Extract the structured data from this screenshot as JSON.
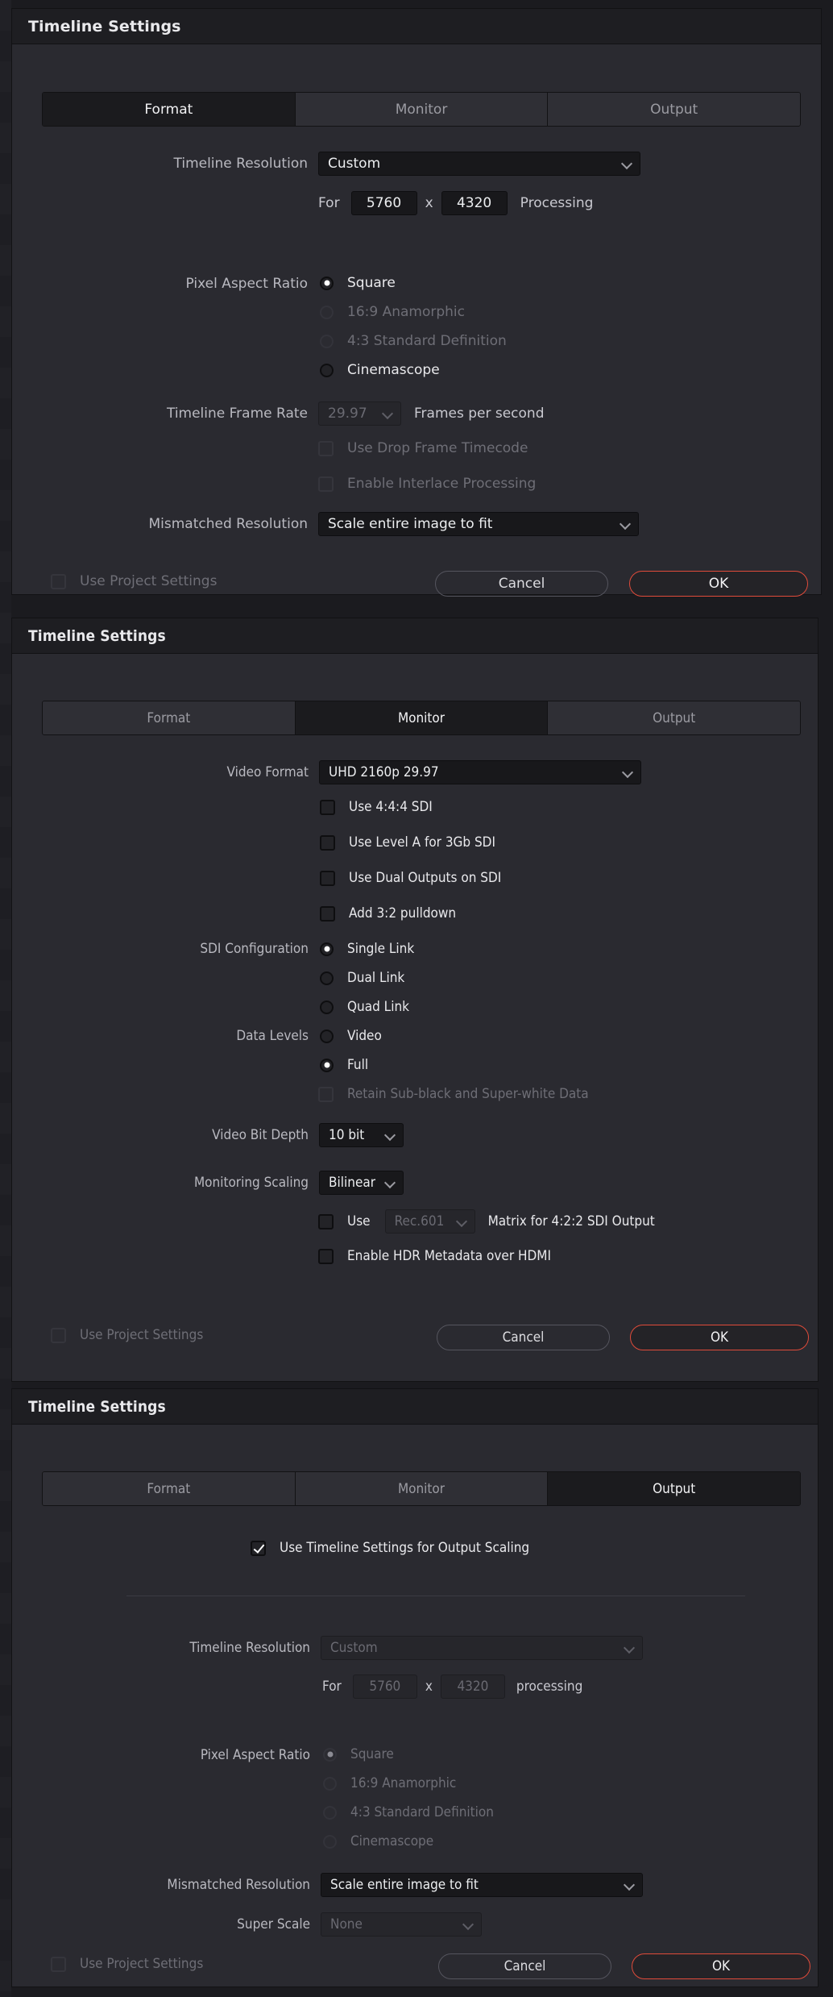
{
  "dialogs": [
    {
      "title": "Timeline Settings",
      "tabs": [
        {
          "label": "Format",
          "active": true
        },
        {
          "label": "Monitor",
          "active": false
        },
        {
          "label": "Output",
          "active": false
        }
      ],
      "fields": {
        "timeline_resolution_label": "Timeline Resolution",
        "timeline_resolution_value": "Custom",
        "for_label": "For",
        "width_value": "5760",
        "x_label": "x",
        "height_value": "4320",
        "processing_label": "Processing",
        "pixel_aspect_label": "Pixel Aspect Ratio",
        "pixel_aspect_options": [
          {
            "label": "Square",
            "selected": true,
            "disabled": false
          },
          {
            "label": "16:9 Anamorphic",
            "selected": false,
            "disabled": true
          },
          {
            "label": "4:3 Standard Definition",
            "selected": false,
            "disabled": true
          },
          {
            "label": "Cinemascope",
            "selected": false,
            "disabled": false
          }
        ],
        "frame_rate_label": "Timeline Frame Rate",
        "frame_rate_value": "29.97",
        "frames_per_second_label": "Frames per second",
        "drop_frame_label": "Use Drop Frame Timecode",
        "interlace_label": "Enable Interlace Processing",
        "mismatched_label": "Mismatched Resolution",
        "mismatched_value": "Scale entire image to fit"
      },
      "footer": {
        "use_project_settings": "Use Project Settings",
        "cancel": "Cancel",
        "ok": "OK"
      }
    },
    {
      "title": "Timeline Settings",
      "tabs": [
        {
          "label": "Format",
          "active": false
        },
        {
          "label": "Monitor",
          "active": true
        },
        {
          "label": "Output",
          "active": false
        }
      ],
      "fields": {
        "video_format_label": "Video Format",
        "video_format_value": "UHD 2160p 29.97",
        "checks_top": [
          {
            "label": "Use 4:4:4 SDI",
            "checked": false
          },
          {
            "label": "Use Level A for 3Gb SDI",
            "checked": false
          },
          {
            "label": "Use Dual Outputs on SDI",
            "checked": false
          },
          {
            "label": "Add 3:2 pulldown",
            "checked": false
          }
        ],
        "sdi_config_label": "SDI Configuration",
        "sdi_config_options": [
          {
            "label": "Single Link",
            "selected": true
          },
          {
            "label": "Dual Link",
            "selected": false
          },
          {
            "label": "Quad Link",
            "selected": false
          }
        ],
        "data_levels_label": "Data Levels",
        "data_levels_options": [
          {
            "label": "Video",
            "selected": false
          },
          {
            "label": "Full",
            "selected": true
          }
        ],
        "retain_label": "Retain Sub-black and Super-white Data",
        "bit_depth_label": "Video Bit Depth",
        "bit_depth_value": "10 bit",
        "monitoring_scaling_label": "Monitoring Scaling",
        "monitoring_scaling_value": "Bilinear",
        "use_label": "Use",
        "matrix_value": "Rec.601",
        "matrix_suffix": "Matrix for 4:2:2 SDI Output",
        "hdr_label": "Enable HDR Metadata over HDMI"
      },
      "footer": {
        "use_project_settings": "Use Project Settings",
        "cancel": "Cancel",
        "ok": "OK"
      }
    },
    {
      "title": "Timeline Settings",
      "tabs": [
        {
          "label": "Format",
          "active": false
        },
        {
          "label": "Monitor",
          "active": false
        },
        {
          "label": "Output",
          "active": true
        }
      ],
      "fields": {
        "use_timeline_settings_label": "Use Timeline Settings for Output Scaling",
        "use_timeline_settings_checked": true,
        "timeline_resolution_label": "Timeline Resolution",
        "timeline_resolution_value": "Custom",
        "for_label": "For",
        "width_value": "5760",
        "x_label": "x",
        "height_value": "4320",
        "processing_label": "processing",
        "pixel_aspect_label": "Pixel Aspect Ratio",
        "pixel_aspect_options": [
          {
            "label": "Square",
            "selected": true
          },
          {
            "label": "16:9 Anamorphic",
            "selected": false
          },
          {
            "label": "4:3 Standard Definition",
            "selected": false
          },
          {
            "label": "Cinemascope",
            "selected": false
          }
        ],
        "mismatched_label": "Mismatched Resolution",
        "mismatched_value": "Scale entire image to fit",
        "super_scale_label": "Super Scale",
        "super_scale_value": "None"
      },
      "footer": {
        "use_project_settings": "Use Project Settings",
        "cancel": "Cancel",
        "ok": "OK"
      }
    }
  ],
  "colors": {
    "accent_ok": "#e04b3a",
    "panel_bg": "#2a2a30",
    "titlebar_bg": "#1e1e22",
    "field_bg": "#18181b"
  }
}
